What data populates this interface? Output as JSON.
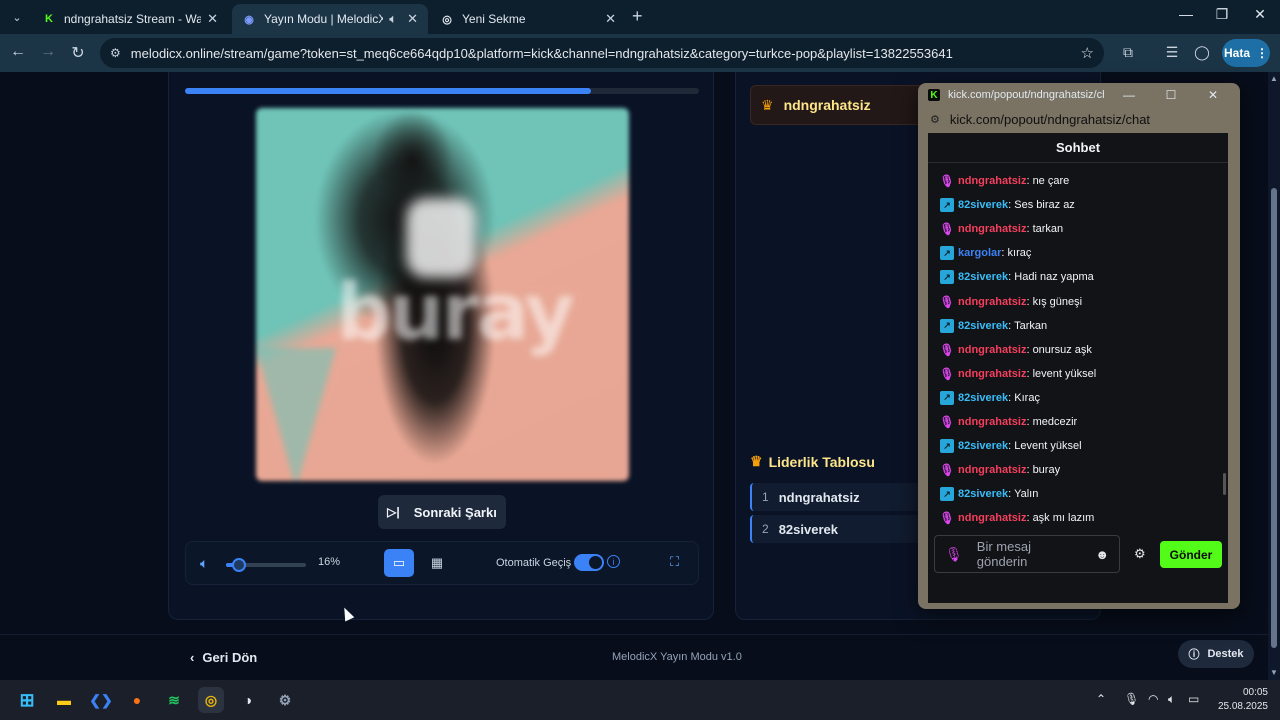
{
  "browser": {
    "tabs": [
      {
        "title": "ndngrahatsiz Stream - Watch Live",
        "favicon": "K",
        "active": false
      },
      {
        "title": "Yayın Modu | MelodicX",
        "favicon": "music-icon",
        "active": true,
        "audio": "speaker-icon"
      },
      {
        "title": "Yeni Sekme",
        "favicon": "chrome-icon",
        "active": false
      }
    ],
    "url": "melodicx.online/stream/game?token=st_meq6ce664qdp10&platform=kick&channel=ndngrahatsiz&category=turkce-pop&playlist=13822553641",
    "profile_label": "Hata"
  },
  "player": {
    "progress_fraction": 0.79,
    "next_label": "Sonraki Şarkı",
    "volume_fraction": 0.16,
    "volume_text": "16%",
    "auto_label": "Otomatik Geçiş",
    "auto_enabled": true,
    "album_word": "buray"
  },
  "right": {
    "streamer": "ndngrahatsiz",
    "leaderboard_title": "Liderlik Tablosu",
    "leaderboard": [
      {
        "rank": "1",
        "name": "ndngrahatsiz"
      },
      {
        "rank": "2",
        "name": "82siverek"
      }
    ]
  },
  "footer": {
    "back_label": "Geri Dön",
    "version": "MelodicX Yayın Modu v1.0",
    "support_label": "Destek"
  },
  "popout": {
    "title": "kick.com/popout/ndngrahatsiz/chat...",
    "url": "kick.com/popout/ndngrahatsiz/chat",
    "chat_title": "Sohbet",
    "messages": [
      {
        "author": "ndngrahatsiz",
        "text": ": ne çare",
        "badge": "mic",
        "color": "#f43f5e"
      },
      {
        "author": "82siverek",
        "text": ": Ses biraz az",
        "badge": "vip",
        "color": "#38bdf8"
      },
      {
        "author": "ndngrahatsiz",
        "text": ": tarkan",
        "badge": "mic",
        "color": "#f43f5e"
      },
      {
        "author": "kargolar",
        "text": ": kıraç",
        "badge": "vip",
        "color": "#3b82f6"
      },
      {
        "author": "82siverek",
        "text": ": Hadi naz yapma",
        "badge": "vip",
        "color": "#38bdf8"
      },
      {
        "author": "ndngrahatsiz",
        "text": ": kış güneşi",
        "badge": "mic",
        "color": "#f43f5e"
      },
      {
        "author": "82siverek",
        "text": ": Tarkan",
        "badge": "vip",
        "color": "#38bdf8"
      },
      {
        "author": "ndngrahatsiz",
        "text": ": onursuz aşk",
        "badge": "mic",
        "color": "#f43f5e"
      },
      {
        "author": "ndngrahatsiz",
        "text": ": levent yüksel",
        "badge": "mic",
        "color": "#f43f5e"
      },
      {
        "author": "82siverek",
        "text": ": Kıraç",
        "badge": "vip",
        "color": "#38bdf8"
      },
      {
        "author": "ndngrahatsiz",
        "text": ": medcezir",
        "badge": "mic",
        "color": "#f43f5e"
      },
      {
        "author": "82siverek",
        "text": ": Levent yüksel",
        "badge": "vip",
        "color": "#38bdf8"
      },
      {
        "author": "ndngrahatsiz",
        "text": ": buray",
        "badge": "mic",
        "color": "#f43f5e"
      },
      {
        "author": "82siverek",
        "text": ": Yalın",
        "badge": "vip",
        "color": "#38bdf8"
      },
      {
        "author": "ndngrahatsiz",
        "text": ": aşk mı lazım",
        "badge": "mic",
        "color": "#f43f5e"
      }
    ],
    "input_placeholder": "Bir mesaj gönderin",
    "send_label": "Gönder"
  },
  "taskbar": {
    "time": "00:05",
    "date": "25.08.2025"
  }
}
